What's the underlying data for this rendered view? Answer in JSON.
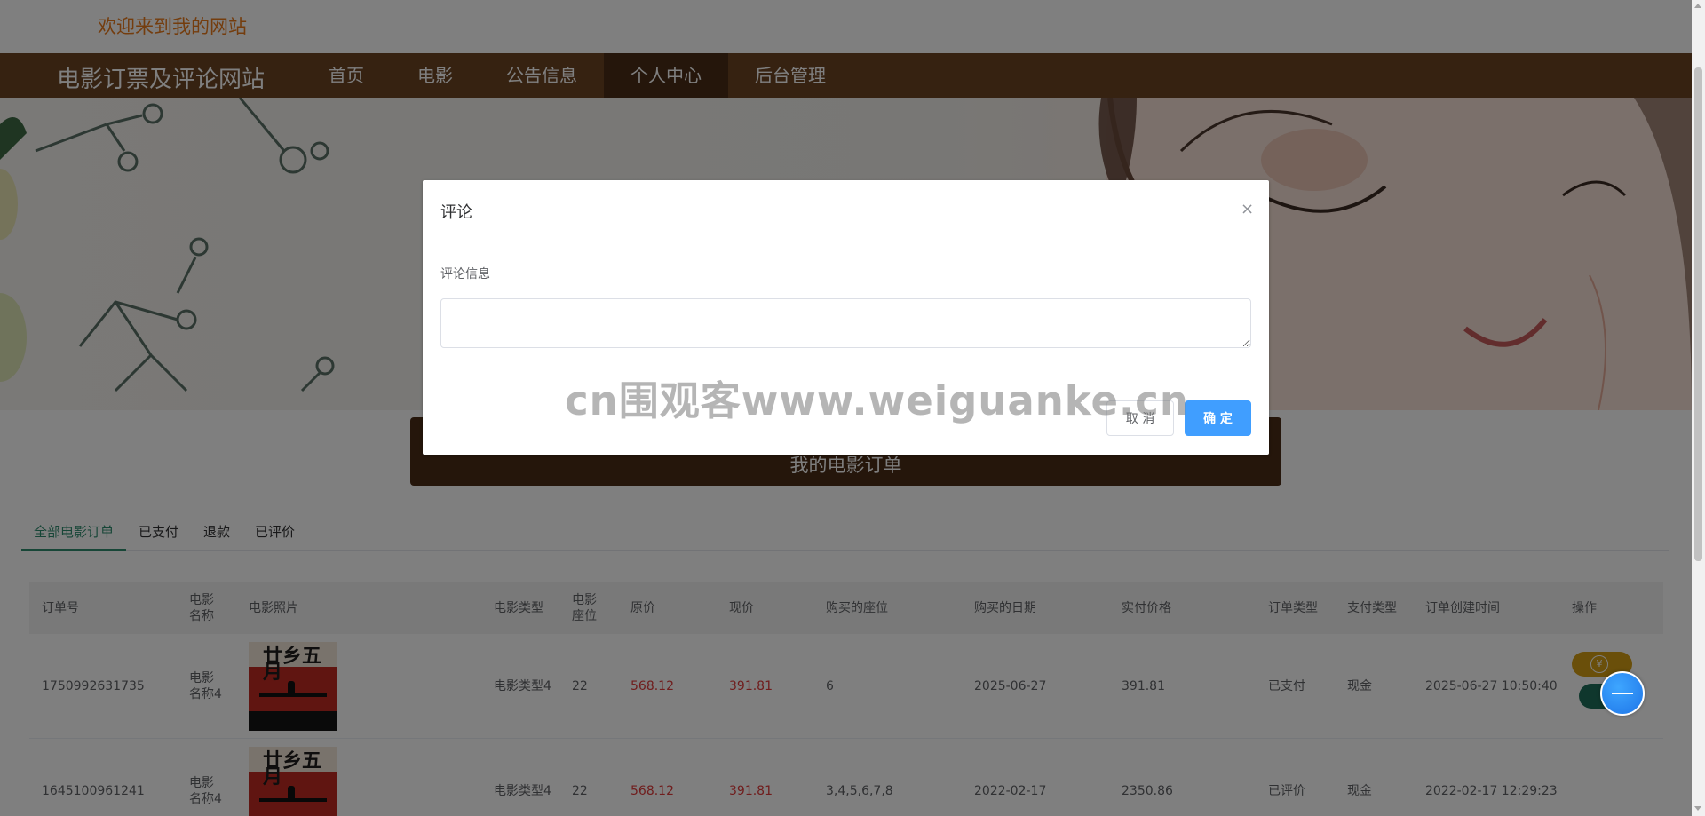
{
  "header": {
    "welcome": "欢迎来到我的网站",
    "brand": "电影订票及评论网站"
  },
  "nav": {
    "items": [
      {
        "label": "首页"
      },
      {
        "label": "电影"
      },
      {
        "label": "公告信息"
      },
      {
        "label": "个人中心",
        "active": true
      },
      {
        "label": "后台管理"
      }
    ]
  },
  "page": {
    "title": "我的电影订单"
  },
  "tabs": [
    {
      "label": "全部电影订单",
      "active": true
    },
    {
      "label": "已支付"
    },
    {
      "label": "退款"
    },
    {
      "label": "已评价"
    }
  ],
  "table": {
    "columns": [
      "订单号",
      "电影名称",
      "电影照片",
      "电影类型",
      "电影座位",
      "原价",
      "现价",
      "购买的座位",
      "购买的日期",
      "实付价格",
      "订单类型",
      "支付类型",
      "订单创建时间",
      "操作"
    ],
    "rows": [
      {
        "order_no": "1750992631735",
        "movie_name": "电影名称4",
        "poster_text": "廿乡五月",
        "movie_type": "电影类型4",
        "seats": "22",
        "original_price": "568.12",
        "current_price": "391.81",
        "bought_seats": "6",
        "date": "2025-06-27",
        "paid": "391.81",
        "order_type": "已支付",
        "pay_type": "现金",
        "created": "2025-06-27 10:50:40"
      },
      {
        "order_no": "1645100961241",
        "movie_name": "电影名称4",
        "poster_text": "廿乡五月",
        "movie_type": "电影类型4",
        "seats": "22",
        "original_price": "568.12",
        "current_price": "391.81",
        "bought_seats": "3,4,5,6,7,8",
        "date": "2022-02-17",
        "paid": "2350.86",
        "order_type": "已评价",
        "pay_type": "现金",
        "created": "2022-02-17 12:29:23"
      }
    ]
  },
  "dialog": {
    "title": "评论",
    "close": "×",
    "field_label": "评论信息",
    "textarea_value": "",
    "cancel_label": "取 消",
    "confirm_label": "确 定"
  },
  "watermark": "cn围观客www.weiguanke.cn",
  "colors": {
    "nav_bg": "#6c4423",
    "nav_active": "#4b2d17",
    "welcome_text": "#e97a1c",
    "tab_active": "#2f8c6f",
    "price_red": "#e03b3b",
    "confirm_blue": "#409eff"
  }
}
